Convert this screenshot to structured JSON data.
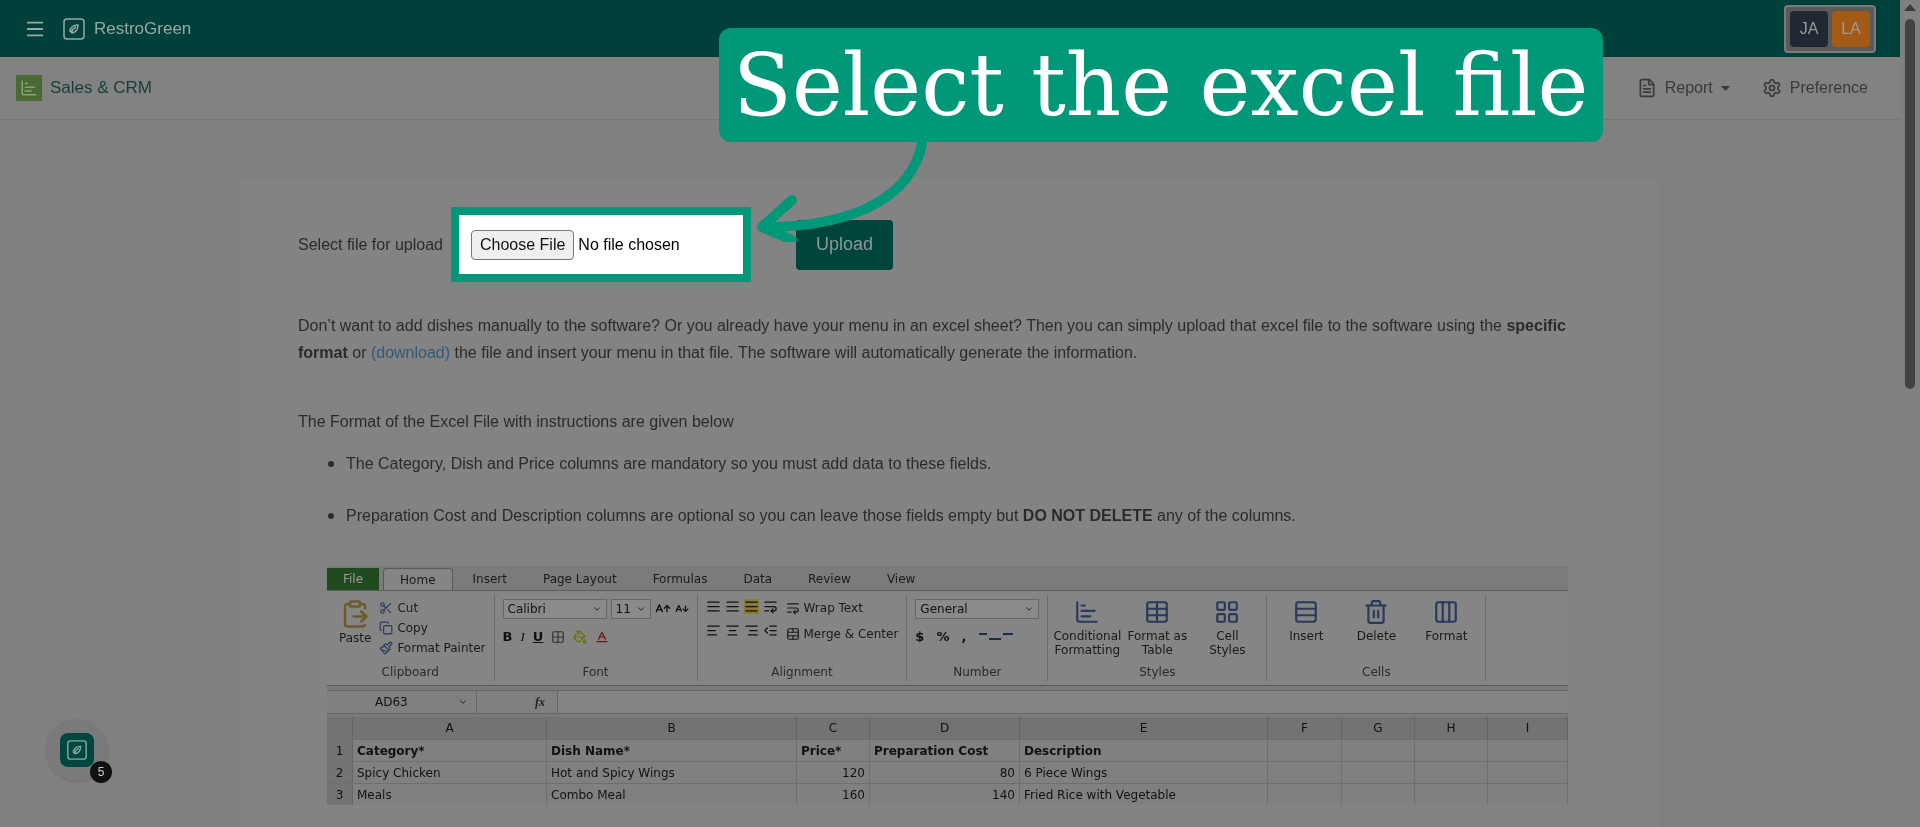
{
  "top_bar": {
    "app_name": "RestroGreen",
    "avatars": [
      {
        "initials": "JA",
        "color": "#1f2833"
      },
      {
        "initials": "LA",
        "color": "#a45a17"
      }
    ]
  },
  "module_bar": {
    "title": "Sales & CRM",
    "menu": [
      {
        "label": "Report",
        "kind": "dropdown"
      },
      {
        "label": "Preference",
        "kind": "settings"
      }
    ]
  },
  "tour_callout": {
    "text": "Select the excel file"
  },
  "upload": {
    "label": "Select file for upload",
    "choose_button": "Choose File",
    "file_status": "No file chosen",
    "upload_button": "Upload"
  },
  "intro": {
    "text_before": "Don’t want to add dishes manually to the software? Or you already have your menu in an excel sheet? Then you can simply upload that excel file to the software using the **specific format** or",
    "link": "(download)",
    "text_after": "the file and insert your menu in that file. The software will automatically generate the information."
  },
  "format_heading": "The Format of the Excel File with instructions are given below",
  "instructions": [
    "The Category, Dish and Price columns are mandatory so you must add data to these fields.",
    "Preparation Cost and Description columns are optional so you can leave those fields empty but **DO NOT DELETE** any of the columns."
  ],
  "excel_screenshot": {
    "tabs": [
      {
        "label": "File",
        "kind": "backstage",
        "selected": false
      },
      {
        "label": "Home",
        "kind": "tab",
        "selected": true
      },
      {
        "label": "Insert",
        "kind": "tab",
        "selected": false
      },
      {
        "label": "Page Layout",
        "kind": "tab",
        "selected": false
      },
      {
        "label": "Formulas",
        "kind": "tab",
        "selected": false
      },
      {
        "label": "Data",
        "kind": "tab",
        "selected": false
      },
      {
        "label": "Review",
        "kind": "tab",
        "selected": false
      },
      {
        "label": "View",
        "kind": "tab",
        "selected": false
      }
    ],
    "ribbon_groups": [
      {
        "kind": "clipboard",
        "name": "Clipboard",
        "paste": "Paste",
        "items": [
          "Cut",
          "Copy",
          "Format Painter"
        ]
      },
      {
        "kind": "font",
        "name": "Font",
        "font_family": "Calibri",
        "font_size": "11",
        "buttons": [
          "B",
          "I",
          "U"
        ]
      },
      {
        "kind": "alignment",
        "name": "Alignment",
        "items": [
          "Wrap Text",
          "Merge & Center"
        ]
      },
      {
        "kind": "number",
        "name": "Number",
        "format": "General",
        "symbols": [
          "$",
          "%",
          ","
        ]
      },
      {
        "kind": "styles",
        "name": "Styles",
        "items": [
          "Conditional Formatting",
          "Format as Table",
          "Cell Styles"
        ]
      },
      {
        "kind": "cells",
        "name": "Cells",
        "items": [
          "Insert",
          "Delete",
          "Format"
        ]
      }
    ],
    "formula_bar": {
      "cell_ref": "AD63",
      "function_label": "fx"
    },
    "columns": [
      "A",
      "B",
      "C",
      "D",
      "E",
      "F",
      "G",
      "H",
      "I"
    ],
    "rows": [
      {
        "number": "1",
        "kind": "header",
        "cells": [
          {
            "text": "Category*",
            "numeric": false
          },
          {
            "text": "Dish Name*",
            "numeric": false
          },
          {
            "text": "Price*",
            "numeric": false
          },
          {
            "text": "Preparation Cost",
            "numeric": false
          },
          {
            "text": "Description",
            "numeric": false
          }
        ]
      },
      {
        "number": "2",
        "kind": "data",
        "cells": [
          {
            "text": "Spicy Chicken",
            "numeric": false
          },
          {
            "text": "Hot and Spicy Wings",
            "numeric": false
          },
          {
            "text": "120",
            "numeric": true
          },
          {
            "text": "80",
            "numeric": true
          },
          {
            "text": "6 Piece Wings",
            "numeric": false
          }
        ]
      },
      {
        "number": "3",
        "kind": "data",
        "cells": [
          {
            "text": "Meals",
            "numeric": false
          },
          {
            "text": "Combo Meal",
            "numeric": false
          },
          {
            "text": "160",
            "numeric": true
          },
          {
            "text": "140",
            "numeric": true
          },
          {
            "text": "Fried Rice with Vegetable",
            "numeric": false
          }
        ]
      }
    ]
  },
  "help_button": {
    "badge": "5"
  }
}
